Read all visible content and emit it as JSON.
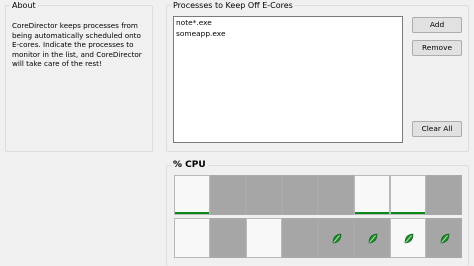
{
  "about": {
    "title": "About",
    "text": "CoreDirector keeps processes from\nbeing automatically scheduled onto\nE-cores. Indicate the processes to\nmonitor in the list, and CoreDirector\nwill take care of the rest!"
  },
  "processes": {
    "title": "Processes to Keep Off E-Cores",
    "items": [
      "note*.exe",
      "someapp.exe"
    ],
    "add_label": "Add",
    "remove_label": "Remove",
    "clear_label": "Clear All"
  },
  "cpu": {
    "title": "% CPU",
    "rows": [
      [
        {
          "state": "light",
          "usage_indicator": "green-bar",
          "ecore": false
        },
        {
          "state": "dark",
          "ecore": false
        },
        {
          "state": "dark",
          "ecore": false
        },
        {
          "state": "dark",
          "ecore": false
        },
        {
          "state": "dark",
          "ecore": false
        },
        {
          "state": "light",
          "usage_indicator": "green-bar",
          "ecore": false
        },
        {
          "state": "light",
          "usage_indicator": "green-bar",
          "ecore": false
        },
        {
          "state": "dark",
          "ecore": false
        }
      ],
      [
        {
          "state": "light",
          "ecore": false
        },
        {
          "state": "dark",
          "ecore": false
        },
        {
          "state": "light",
          "ecore": false
        },
        {
          "state": "dark",
          "ecore": false
        },
        {
          "state": "dark",
          "ecore": true,
          "icon": "leaf-icon"
        },
        {
          "state": "dark",
          "ecore": true,
          "icon": "leaf-icon"
        },
        {
          "state": "light",
          "ecore": true,
          "icon": "leaf-icon"
        },
        {
          "state": "dark",
          "ecore": true,
          "icon": "leaf-icon"
        }
      ]
    ],
    "colors": {
      "idle_dark": "#a6a6a6",
      "idle_light": "#f8f8f8",
      "usage_green": "#0a8a1a",
      "leaf_green": "#1f8a2a"
    }
  }
}
